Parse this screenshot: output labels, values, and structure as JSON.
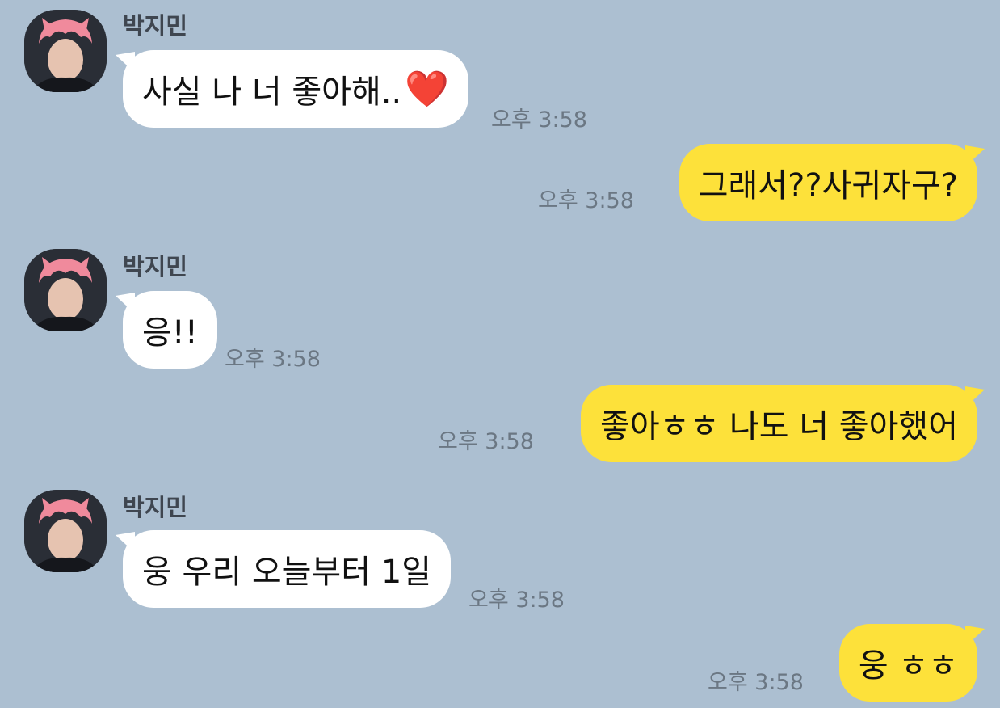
{
  "colors": {
    "background": "#acbfd1",
    "incoming_bubble": "#ffffff",
    "outgoing_bubble": "#fde13a",
    "timestamp": "#6b7783",
    "sender_name": "#3f4650"
  },
  "messages": [
    {
      "direction": "incoming",
      "sender": "박지민",
      "text": "사실 나 너 좋아해..",
      "emoji": "❤️",
      "time": "오후 3:58"
    },
    {
      "direction": "outgoing",
      "text": "그래서??사귀자구?",
      "time": "오후 3:58"
    },
    {
      "direction": "incoming",
      "sender": "박지민",
      "text": "응!!",
      "time": "오후 3:58"
    },
    {
      "direction": "outgoing",
      "text": "좋아ㅎㅎ 나도 너 좋아했어",
      "time": "오후 3:58"
    },
    {
      "direction": "incoming",
      "sender": "박지민",
      "text": "웅 우리 오늘부터 1일",
      "time": "오후 3:58"
    },
    {
      "direction": "outgoing",
      "text": "웅 ㅎㅎ",
      "time": "오후 3:58"
    }
  ]
}
